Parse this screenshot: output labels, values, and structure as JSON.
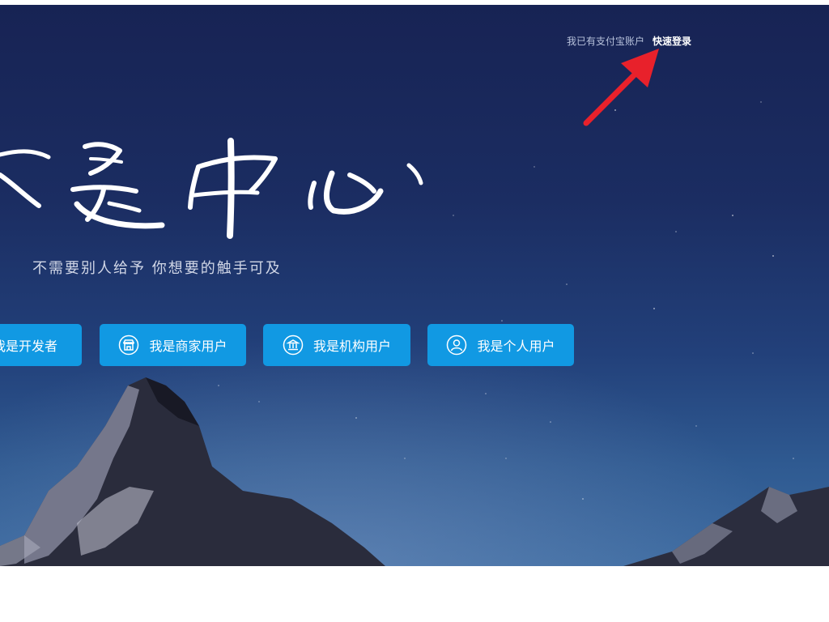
{
  "login": {
    "prompt": "我已有支付宝账户",
    "link": "快速登录"
  },
  "hero": {
    "calligraphy_icon": "handwritten-title-logo",
    "slogan": "不需要别人给予 你想要的触手可及"
  },
  "roles": {
    "developer": {
      "label": "我是开发者"
    },
    "merchant": {
      "label": "我是商家用户",
      "icon": "shop-icon"
    },
    "organization": {
      "label": "我是机构用户",
      "icon": "bank-icon"
    },
    "personal": {
      "label": "我是个人用户",
      "icon": "user-icon"
    }
  },
  "colors": {
    "button": "#1199e3",
    "sky_top": "#172354",
    "arrow": "#e8212b"
  }
}
